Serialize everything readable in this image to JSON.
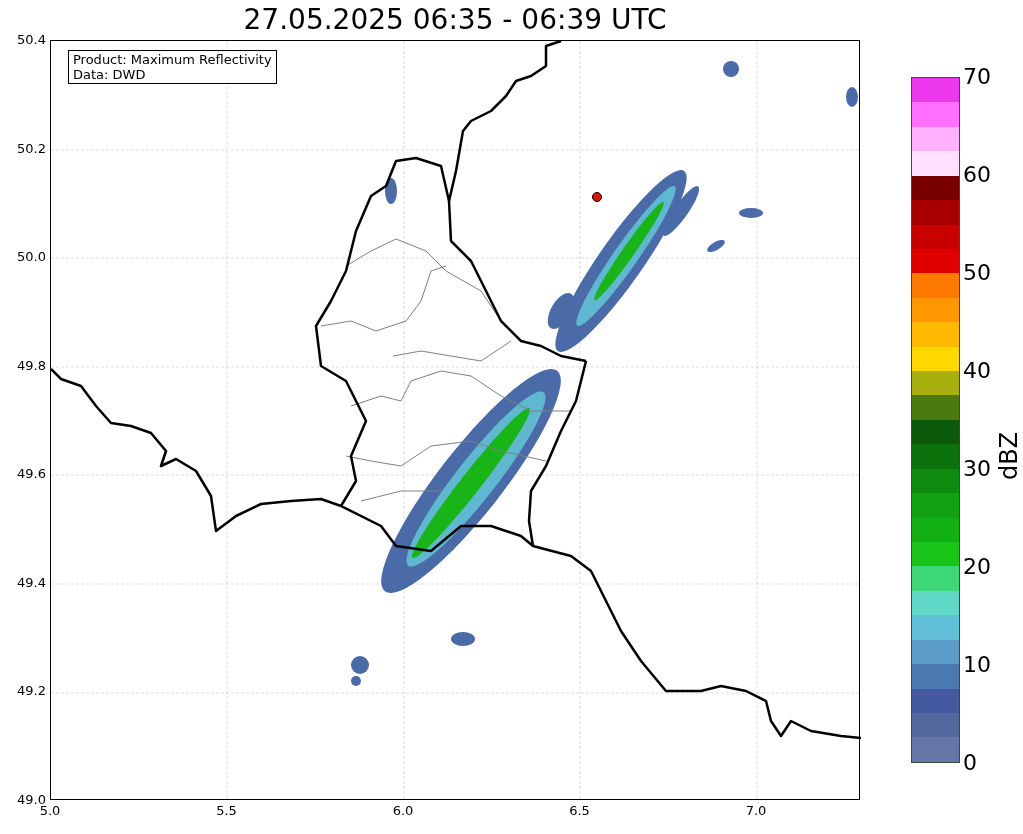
{
  "title": "27.05.2025 06:35 - 06:39 UTC",
  "legend": {
    "lines": [
      "Product: Maximum Reflectivity",
      "Data: DWD"
    ]
  },
  "map": {
    "xticks": [
      "5.0",
      "5.5",
      "6.0",
      "6.5",
      "7.0"
    ],
    "yticks": [
      "50.4",
      "50.2",
      "50.0",
      "49.8",
      "49.6",
      "49.4",
      "49.2",
      "49.0"
    ]
  },
  "colorbar": {
    "label": "dBZ",
    "ticks": [
      "70",
      "60",
      "50",
      "40",
      "30",
      "20",
      "10",
      "0"
    ],
    "segments": [
      {
        "color": "#ee38ee"
      },
      {
        "color": "#ff70ff"
      },
      {
        "color": "#ffb0ff"
      },
      {
        "color": "#ffe0ff"
      },
      {
        "color": "#780000"
      },
      {
        "color": "#a80000"
      },
      {
        "color": "#c80000"
      },
      {
        "color": "#e00000"
      },
      {
        "color": "#ff7800"
      },
      {
        "color": "#ff9800"
      },
      {
        "color": "#ffb800"
      },
      {
        "color": "#ffd800"
      },
      {
        "color": "#a8b010"
      },
      {
        "color": "#4a7a10"
      },
      {
        "color": "#0a5a0a"
      },
      {
        "color": "#0c720c"
      },
      {
        "color": "#0e8a0e"
      },
      {
        "color": "#10a010"
      },
      {
        "color": "#12b012"
      },
      {
        "color": "#18c418"
      },
      {
        "color": "#3ed878"
      },
      {
        "color": "#5fd8c8"
      },
      {
        "color": "#62bfd8"
      },
      {
        "color": "#5b9dc8"
      },
      {
        "color": "#4a78b0"
      },
      {
        "color": "#4459a0"
      },
      {
        "color": "#5468a0"
      },
      {
        "color": "#6577a8"
      }
    ]
  }
}
